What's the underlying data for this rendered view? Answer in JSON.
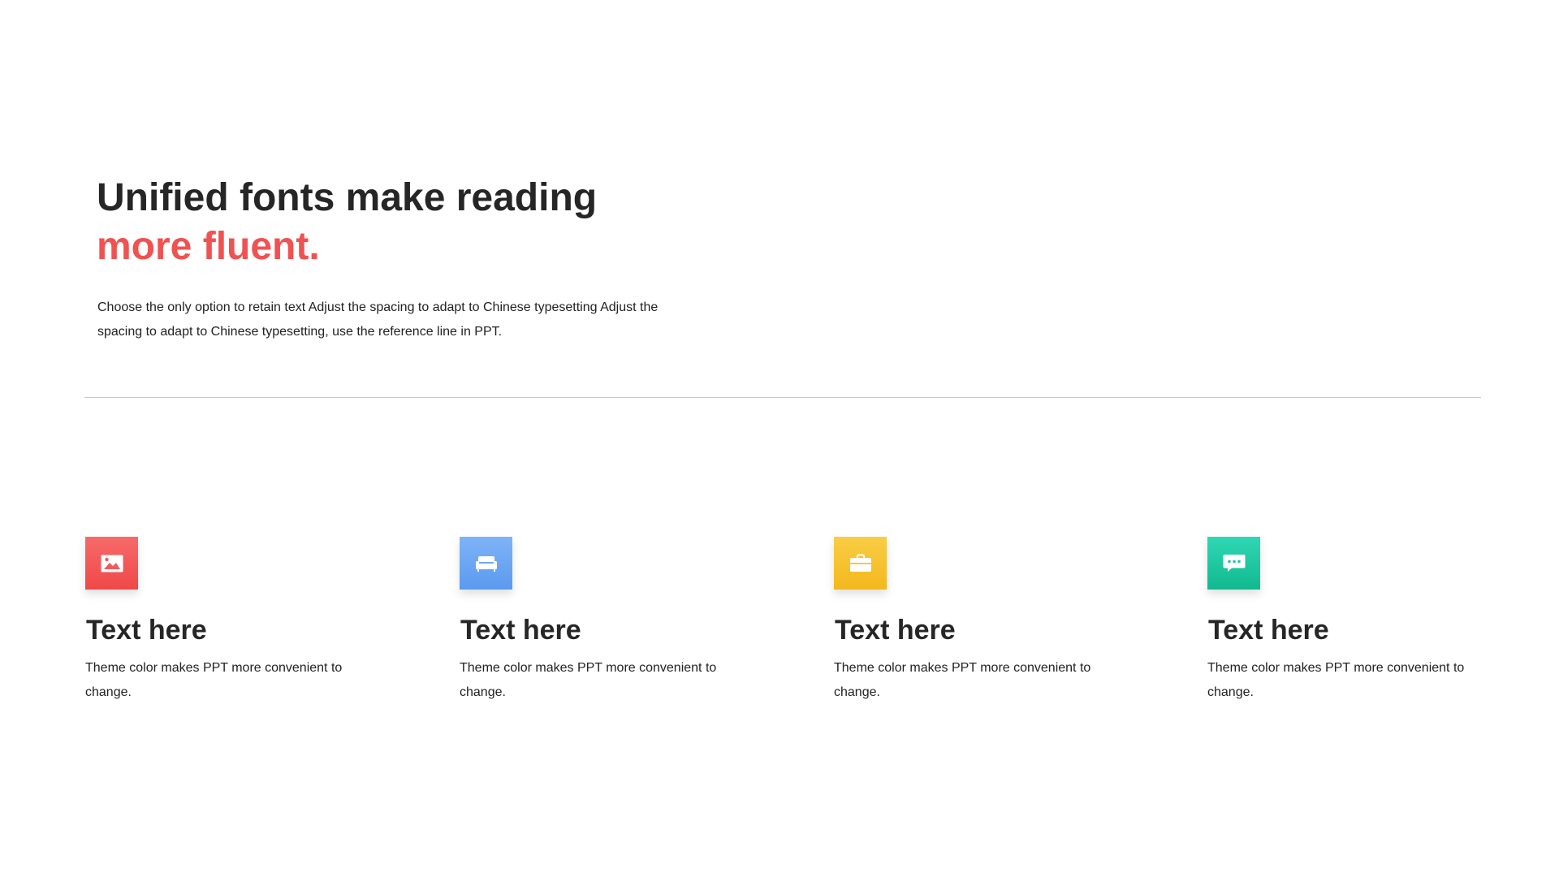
{
  "header": {
    "title_line1": "Unified fonts make reading",
    "title_line2": "more fluent.",
    "accent_color": "#f05252",
    "body": "Choose the only option to retain text Adjust the spacing to adapt to Chinese typesetting Adjust the spacing to adapt to Chinese typesetting, use the reference line in PPT."
  },
  "features": [
    {
      "icon": "image-icon",
      "color": "#f25a5a",
      "title": "Text here",
      "description": "Theme color makes PPT more convenient to change."
    },
    {
      "icon": "sofa-icon",
      "color": "#6aa6f3",
      "title": "Text here",
      "description": "Theme color makes PPT more convenient to change."
    },
    {
      "icon": "briefcase-icon",
      "color": "#f6c22f",
      "title": "Text here",
      "description": "Theme color makes PPT more convenient to change."
    },
    {
      "icon": "chat-bubble-icon",
      "color": "#1dc9a0",
      "title": "Text here",
      "description": "Theme color makes PPT more convenient to change."
    }
  ]
}
